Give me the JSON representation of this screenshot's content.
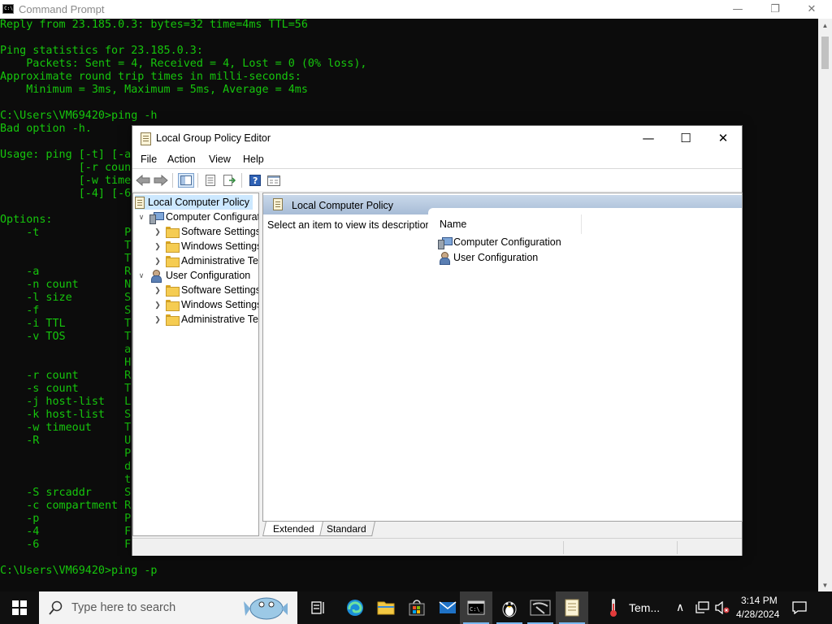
{
  "cmd": {
    "title": "Command Prompt",
    "lines": [
      "Reply from 23.185.0.3: bytes=32 time=4ms TTL=56",
      "",
      "Ping statistics for 23.185.0.3:",
      "    Packets: Sent = 4, Received = 4, Lost = 0 (0% loss),",
      "Approximate round trip times in milli-seconds:",
      "    Minimum = 3ms, Maximum = 5ms, Average = 4ms",
      "",
      "C:\\Users\\VM69420>ping -h",
      "Bad option -h.",
      "",
      "Usage: ping [-t] [-a",
      "            [-r coun",
      "            [-w time",
      "            [-4] [-6",
      "",
      "Options:",
      "    -t             P",
      "                   T",
      "                   T",
      "    -a             R",
      "    -n count       N",
      "    -l size        S",
      "    -f             S",
      "    -i TTL         T",
      "    -v TOS         T",
      "                   a",
      "                   H",
      "    -r count       R",
      "    -s count       T",
      "    -j host-list   L",
      "    -k host-list   S",
      "    -w timeout     T",
      "    -R             U",
      "                   P",
      "                   d",
      "                   t",
      "    -S srcaddr     S",
      "    -c compartment R",
      "    -p             P",
      "    -4             F",
      "    -6             F",
      "",
      "C:\\Users\\VM69420>ping -p"
    ]
  },
  "gpe": {
    "title": "Local Group Policy Editor",
    "menu": [
      "File",
      "Action",
      "View",
      "Help"
    ],
    "tree": {
      "root": "Local Computer Policy",
      "computer": "Computer Configuration",
      "computer_children": [
        "Software Settings",
        "Windows Settings",
        "Administrative Templates"
      ],
      "user": "User Configuration",
      "user_children": [
        "Software Settings",
        "Windows Settings",
        "Administrative Templates"
      ]
    },
    "content": {
      "header": "Local Computer Policy",
      "description": "Select an item to view its description.",
      "column_name": "Name",
      "items": [
        "Computer Configuration",
        "User Configuration"
      ]
    },
    "tabs": [
      "Extended",
      "Standard"
    ]
  },
  "taskbar": {
    "search_placeholder": "Type here to search",
    "weather": "Tem...",
    "time": "3:14 PM",
    "date": "4/28/2024"
  },
  "colors": {
    "console_text": "#16c60c",
    "console_bg": "#0c0c0c",
    "selection": "#cce8ff",
    "taskbar": "#101010"
  }
}
